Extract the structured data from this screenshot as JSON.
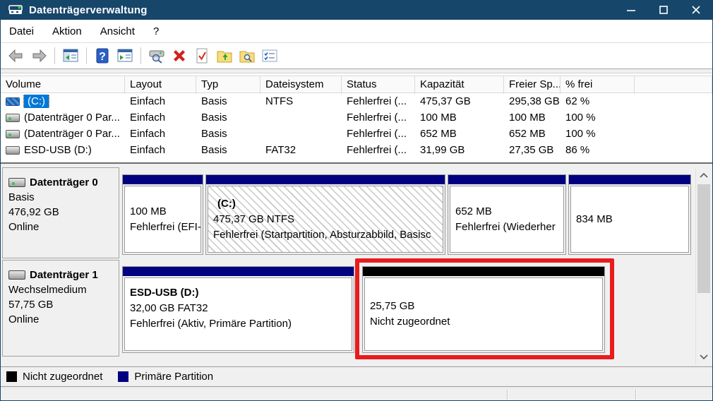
{
  "window": {
    "title": "Datenträgerverwaltung"
  },
  "menu": {
    "items": [
      {
        "label": "Datei"
      },
      {
        "label": "Aktion"
      },
      {
        "label": "Ansicht"
      },
      {
        "label": "?"
      }
    ]
  },
  "toolbar": {
    "icons": [
      "back",
      "forward",
      "show-console-tree",
      "help",
      "show-action-pane",
      "disk-rescan",
      "delete-volume",
      "properties-check",
      "export-folder",
      "search-folder",
      "settings-list"
    ]
  },
  "volume_table": {
    "columns": {
      "volume": "Volume",
      "layout": "Layout",
      "typ": "Typ",
      "dateisystem": "Dateisystem",
      "status": "Status",
      "kapazitaet": "Kapazität",
      "freier_sp": "Freier Sp...",
      "prozent_frei": "% frei"
    },
    "rows": [
      {
        "volume": "(C:)",
        "layout": "Einfach",
        "typ": "Basis",
        "dateisystem": "NTFS",
        "status": "Fehlerfrei (...",
        "kapazitaet": "475,37 GB",
        "freier_sp": "295,38 GB",
        "prozent_frei": "62 %"
      },
      {
        "volume": "(Datenträger 0 Par...",
        "layout": "Einfach",
        "typ": "Basis",
        "dateisystem": "",
        "status": "Fehlerfrei (...",
        "kapazitaet": "100 MB",
        "freier_sp": "100 MB",
        "prozent_frei": "100 %"
      },
      {
        "volume": "(Datenträger 0 Par...",
        "layout": "Einfach",
        "typ": "Basis",
        "dateisystem": "",
        "status": "Fehlerfrei (...",
        "kapazitaet": "652 MB",
        "freier_sp": "652 MB",
        "prozent_frei": "100 %"
      },
      {
        "volume": "ESD-USB (D:)",
        "layout": "Einfach",
        "typ": "Basis",
        "dateisystem": "FAT32",
        "status": "Fehlerfrei (...",
        "kapazitaet": "31,99 GB",
        "freier_sp": "27,35 GB",
        "prozent_frei": "86 %"
      }
    ]
  },
  "disks": [
    {
      "name": "Datenträger 0",
      "medium": "Basis",
      "size": "476,92 GB",
      "status": "Online",
      "partitions": [
        {
          "title": "",
          "line1": "100 MB",
          "line2": "Fehlerfrei (EFI-"
        },
        {
          "title": "(C:)",
          "line1": "475,37 GB NTFS",
          "line2": "Fehlerfrei (Startpartition, Absturzabbild, Basisc"
        },
        {
          "title": "",
          "line1": "652 MB",
          "line2": "Fehlerfrei (Wiederher"
        },
        {
          "title": "",
          "line1": "834 MB",
          "line2": ""
        }
      ]
    },
    {
      "name": "Datenträger 1",
      "medium": "Wechselmedium",
      "size": "57,75 GB",
      "status": "Online",
      "partitions": [
        {
          "title": "ESD-USB (D:)",
          "line1": "32,00 GB FAT32",
          "line2": "Fehlerfrei (Aktiv, Primäre Partition)"
        },
        {
          "title": "",
          "line1": "25,75 GB",
          "line2": "Nicht zugeordnet"
        }
      ]
    }
  ],
  "legend": {
    "unallocated": "Nicht zugeordnet",
    "primary": "Primäre Partition"
  },
  "colors": {
    "titlebar": "#17466b",
    "primary_partition": "#000080",
    "unallocated": "#000000",
    "selection": "#0078d7",
    "highlight_box": "#e81c1c"
  }
}
